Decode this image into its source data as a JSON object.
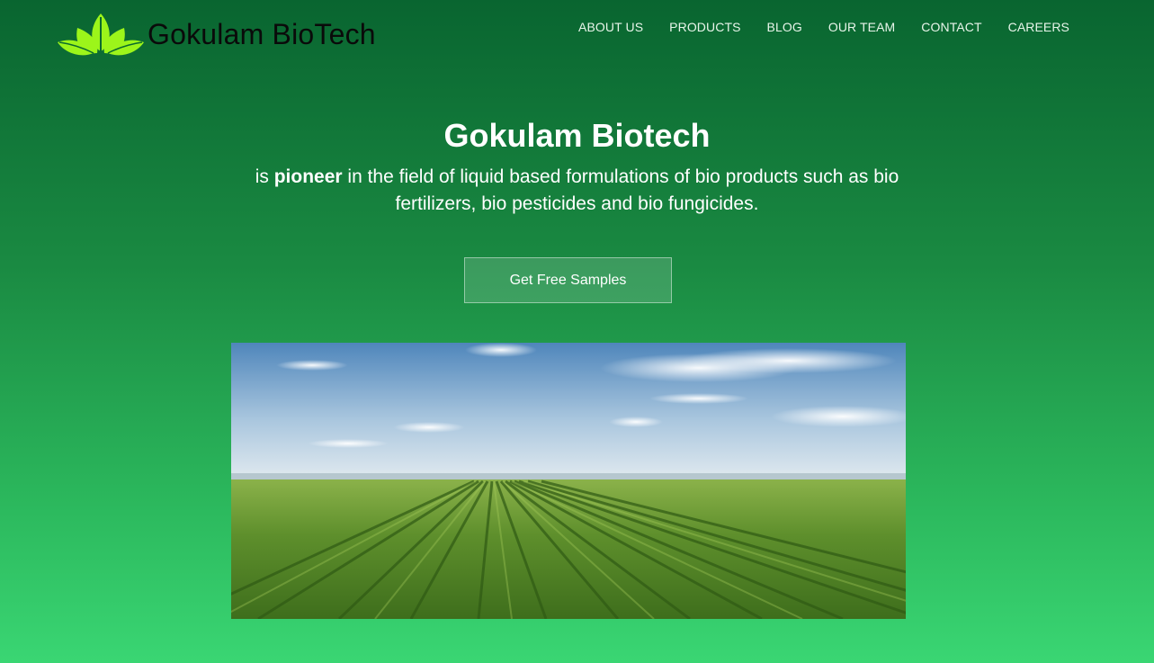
{
  "header": {
    "logo_text": "Gokulam BioTech",
    "logo_icon": "three-leaves-icon",
    "nav": [
      {
        "label": "ABOUT US"
      },
      {
        "label": "PRODUCTS"
      },
      {
        "label": "BLOG"
      },
      {
        "label": "OUR TEAM"
      },
      {
        "label": "CONTACT"
      },
      {
        "label": "CAREERS"
      }
    ]
  },
  "hero": {
    "title": "Gokulam Biotech",
    "subtitle_prefix": "is ",
    "subtitle_bold": "pioneer",
    "subtitle_rest": " in the field of liquid based formulations of bio products such as bio fertilizers, bio pesticides and bio fungicides.",
    "cta_label": "Get Free Samples"
  },
  "colors": {
    "gradient_top": "#096530",
    "gradient_bottom": "#3ad673",
    "leaf_green": "#9cf51a"
  }
}
